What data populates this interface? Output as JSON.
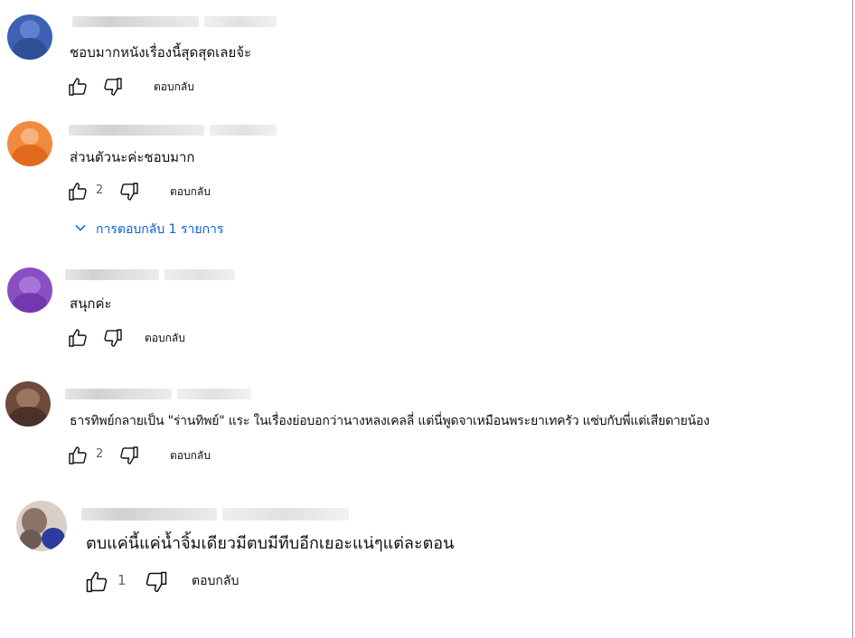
{
  "comments": [
    {
      "text": "ชอบมากหนังเรื่องนี้สุดสุดเลยจ้ะ",
      "likes": "",
      "reply_label": "ตอบกลับ",
      "avatar_color": "#3d62b4"
    },
    {
      "text": "ส่วนตัวนะค่ะชอบมาก",
      "likes": "2",
      "reply_label": "ตอบกลับ",
      "avatar_color": "#f08a3e",
      "replies_toggle": "การตอบกลับ 1 รายการ"
    },
    {
      "text": "สนุกค่ะ",
      "likes": "",
      "reply_label": "ตอบกลับ",
      "avatar_color": "#8b4fc4"
    },
    {
      "text": "ธารทิพย์กลายเป็น \"ร่านทิพย์\" แระ  ในเรื่องย่อบอกว่านางหลงเคลลี่  แต่นี่พูดจาเหมือนพระยาเทครัว  แซ่บกับพี่แต่เสียดายน้อง",
      "likes": "2",
      "reply_label": "ตอบกลับ",
      "avatar_color": "#6e4a3d"
    },
    {
      "text": "ตบแค่นี้แค่น้ำจิ้มเดียวมีตบมีทีบอีกเยอะแน่ๆแต่ละตอน",
      "likes": "1",
      "reply_label": "ตอบกลับ",
      "avatar_color": "#7a6a8c"
    }
  ],
  "colors": {
    "link_blue": "#065fd4",
    "text": "#0f0f0f",
    "meta": "#606060"
  },
  "icons": {
    "like": "thumbs-up-icon",
    "dislike": "thumbs-down-icon",
    "chevron": "chevron-down-icon"
  }
}
